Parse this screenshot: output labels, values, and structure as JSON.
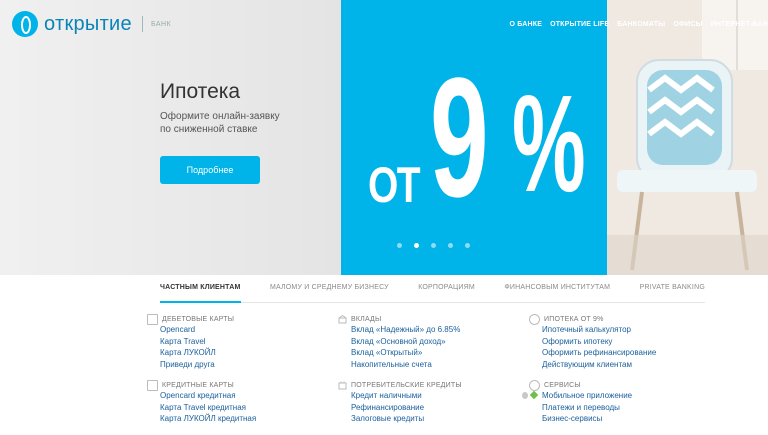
{
  "header": {
    "logo_text": "открытие",
    "logo_sub": "БАНК",
    "nav": [
      "О БАНКЕ",
      "ОТКРЫТИЕ LIFE",
      "БАНКОМАТЫ",
      "ОФИСЫ",
      "ИНТЕРНЕТ-БАН"
    ]
  },
  "hero": {
    "title": "Ипотека",
    "text_line1": "Оформите онлайн-заявку",
    "text_line2": "по сниженной ставке",
    "button_label": "Подробнее",
    "promo_prefix": "ОТ",
    "promo_number": "9",
    "promo_percent": "%",
    "slides_total": 5,
    "active_slide": 2
  },
  "tabs": [
    "ЧАСТНЫМ КЛИЕНТАМ",
    "МАЛОМУ И СРЕДНЕМУ БИЗНЕСУ",
    "КОРПОРАЦИЯМ",
    "ФИНАНСОВЫМ ИНСТИТУТАМ",
    "PRIVATE BANKING"
  ],
  "columns": {
    "col1": {
      "g1": {
        "heading": "ДЕБЕТОВЫЕ КАРТЫ",
        "icon": "card-icon",
        "links": [
          "Opencard",
          "Карта Travel",
          "Карта ЛУКОЙЛ",
          "Приведи друга"
        ]
      },
      "g2": {
        "heading": "КРЕДИТНЫЕ КАРТЫ",
        "icon": "card-icon",
        "links": [
          "Opencard кредитная",
          "Карта Travel кредитная",
          "Карта ЛУКОЙЛ кредитная"
        ]
      }
    },
    "col2": {
      "g1": {
        "heading": "ВКЛАДЫ",
        "icon": "deposit-icon",
        "links": [
          "Вклад «Надежный» до 6.85%",
          "Вклад «Основной доход»",
          "Вклад «Открытый»",
          "Накопительные счета"
        ]
      },
      "g2": {
        "heading": "ПОТРЕБИТЕЛЬСКИЕ КРЕДИТЫ",
        "icon": "credit-icon",
        "links": [
          "Кредит наличными",
          "Рефинансирование",
          "Залоговые кредиты"
        ]
      }
    },
    "col3": {
      "g1": {
        "heading": "ИПОТЕКА ОТ 9%",
        "icon": "percent-icon",
        "links": [
          "Ипотечный калькулятор",
          "Оформить ипотеку",
          "Оформить рефинансирование",
          "Действующим клиентам"
        ]
      },
      "g2": {
        "heading": "СЕРВИСЫ",
        "icon": "services-icon",
        "links": [
          "Мобильное приложение",
          "Платежи и переводы",
          "Бизнес-сервисы"
        ]
      }
    }
  },
  "colors": {
    "accent": "#00b3e8",
    "link": "#1a5f9c"
  }
}
